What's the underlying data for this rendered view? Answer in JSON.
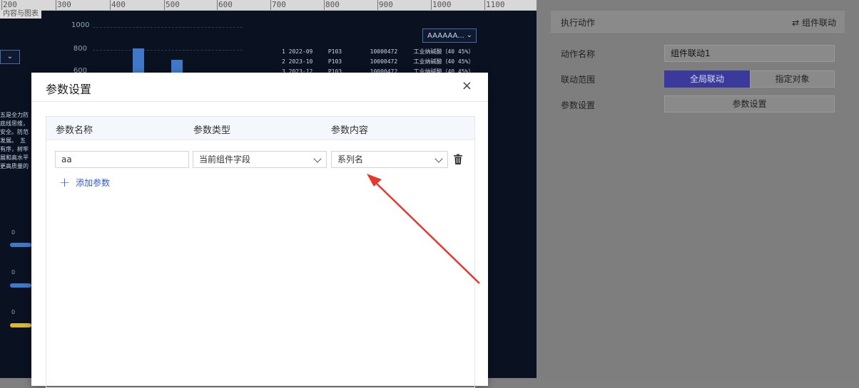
{
  "ruler": {
    "ticks": [
      "200",
      "300",
      "400",
      "500",
      "600",
      "700",
      "800",
      "900",
      "1000",
      "1100"
    ]
  },
  "canvas": {
    "subtitle": "内容与图表",
    "y_ticks": [
      "1000",
      "800",
      "600"
    ],
    "select_right": "AAAAAA...",
    "data_rows": [
      {
        "c1": "1 2022-09",
        "c2": "P103",
        "c3": "10000472",
        "c4": "工业纳碱酸（40 45%）"
      },
      {
        "c1": "2 2023-10",
        "c2": "P103",
        "c3": "10000472",
        "c4": "工业纳碱酸（40 45%）"
      },
      {
        "c1": "3 2023-12",
        "c2": "P103",
        "c3": "10000472",
        "c4": "工业纳碱酸（40 45%）"
      }
    ],
    "text_lines": [
      "五是全力防",
      "底线思维，",
      "安全。防范",
      "发展。　五",
      "有序，树牢",
      "展和高水平",
      "更高质量的"
    ],
    "zeros": [
      "0",
      "0",
      "0"
    ]
  },
  "right_panel": {
    "section_title": "执行动作",
    "section_action": "组件联动",
    "action_name_label": "动作名称",
    "action_name_value": "组件联动1",
    "scope_label": "联动范围",
    "scope_global": "全局联动",
    "scope_specific": "指定对象",
    "param_label": "参数设置",
    "param_button": "参数设置"
  },
  "modal": {
    "title": "参数设置",
    "close": "×",
    "columns": [
      "参数名称",
      "参数类型",
      "参数内容"
    ],
    "row": {
      "name": "aa",
      "type": "当前组件字段",
      "content": "系列名"
    },
    "add_label": "添加参数"
  },
  "colors": {
    "accent": "#2d5bd7",
    "annotation_arrow": "#e8372c"
  }
}
